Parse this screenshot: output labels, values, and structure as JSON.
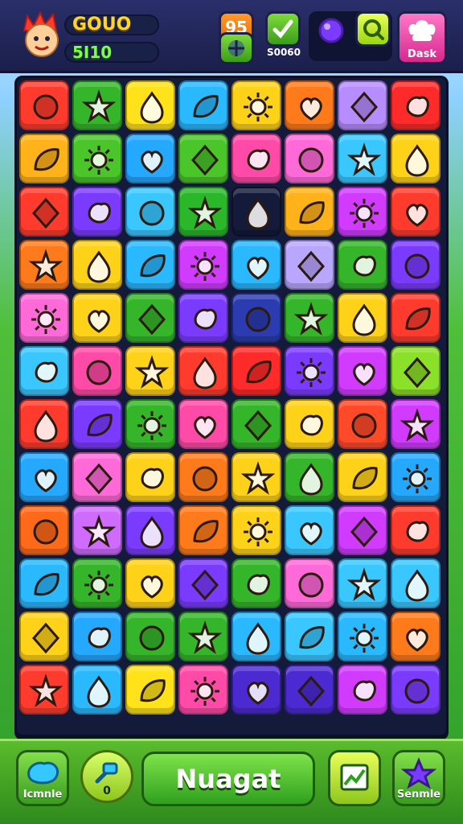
{
  "header": {
    "score": "GOUO",
    "sub_score": "5I10",
    "badge_top": "95",
    "green_button_label": "S0060",
    "pink_button_label": "Dask"
  },
  "board": {
    "rows": [
      [
        "#ff3b2e",
        "#35b52a",
        "#ffe21a",
        "#2ab8ff",
        "#ffd21a",
        "#ff7a1a",
        "#b78cff",
        "#ff2a2a"
      ],
      [
        "#ffb21a",
        "#4ac52a",
        "#25a8ff",
        "#4ac52a",
        "#ff4aa8",
        "#ff6ad8",
        "#3ac7ff",
        "#ffd21a"
      ],
      [
        "#ff3b2e",
        "#7a3bff",
        "#3ac7ff",
        "#2ab82a",
        "#141a3a",
        "#ffb21a",
        "#d13bff",
        "#ff3b2e"
      ],
      [
        "#ff7a1a",
        "#ffd21a",
        "#2ab8ff",
        "#d13bff",
        "#2ab8ff",
        "#b9a6ff",
        "#35b52a",
        "#7a3bff"
      ],
      [
        "#ff6ad8",
        "#ffd21a",
        "#35b52a",
        "#7a3bff",
        "#2b3bb0",
        "#35b52a",
        "#ffd21a",
        "#ff3b2e"
      ],
      [
        "#3ac7ff",
        "#ff4aa8",
        "#ffd21a",
        "#ff3b2e",
        "#ff2a2a",
        "#7a3bff",
        "#d13bff",
        "#8be02a"
      ],
      [
        "#ff3b2e",
        "#7a3bff",
        "#35b52a",
        "#ff4aa8",
        "#35b52a",
        "#ffd21a",
        "#ff4a2a",
        "#d13bff"
      ],
      [
        "#25a8ff",
        "#ff6ad8",
        "#ffd21a",
        "#ff7a1a",
        "#ffd21a",
        "#35b52a",
        "#ffd21a",
        "#25a8ff"
      ],
      [
        "#ff6a1a",
        "#d06bff",
        "#7a3bff",
        "#ff7a1a",
        "#ffd21a",
        "#3ac7ff",
        "#d13bff",
        "#ff3b2e"
      ],
      [
        "#2ab8ff",
        "#35b52a",
        "#ffd21a",
        "#7a3bff",
        "#35b52a",
        "#ff6ad8",
        "#3ac7ff",
        "#3ac7ff"
      ],
      [
        "#ffd21a",
        "#25a8ff",
        "#35b52a",
        "#35b52a",
        "#2ab8ff",
        "#3ac7ff",
        "#2ab8ff",
        "#ff7a1a"
      ],
      [
        "#ff3b2e",
        "#2ab8ff",
        "#ffe21a",
        "#ff4aa8",
        "#4b2ad1",
        "#4b2ad1",
        "#d13bff",
        "#7a3bff"
      ]
    ]
  },
  "footer": {
    "left_button_label": "Icmnle",
    "circle_button_label": "0",
    "play_label": "Nuagat",
    "right_button_label": "Senmle"
  }
}
